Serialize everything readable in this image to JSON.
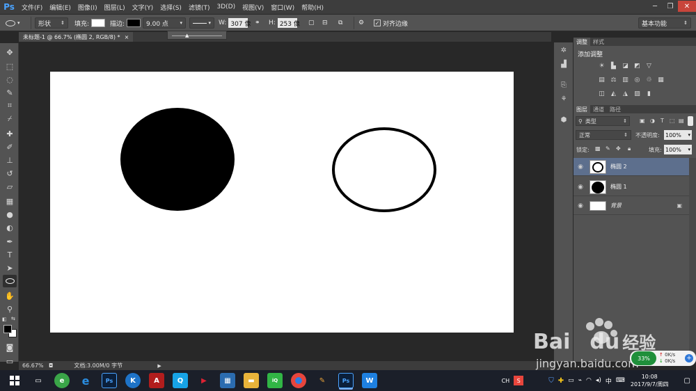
{
  "app": {
    "logo": "Ps"
  },
  "menu": [
    "文件(F)",
    "编辑(E)",
    "图像(I)",
    "图层(L)",
    "文字(Y)",
    "选择(S)",
    "滤镜(T)",
    "3D(D)",
    "视图(V)",
    "窗口(W)",
    "帮助(H)"
  ],
  "options": {
    "tool_mode": "形状",
    "fill_label": "填充:",
    "stroke_label": "描边:",
    "stroke_width": "9.00 点",
    "w_label": "W:",
    "w_value": "307 像",
    "h_label": "H:",
    "h_value": "253 像",
    "align_edges": "对齐边缘",
    "workspace": "基本功能"
  },
  "document": {
    "tab_title": "未标题-1 @ 66.7% (椭圆 2, RGB/8) *",
    "close": "×"
  },
  "status": {
    "zoom": "66.67%",
    "doc_info": "文档:3.00M/0 字节"
  },
  "panels": {
    "adjust_tabs": [
      "调整",
      "样式"
    ],
    "adjust_title": "添加调整",
    "layer_tabs": [
      "图层",
      "通道",
      "路径"
    ],
    "filter_kind": "类型",
    "blend_mode": "正常",
    "opacity_label": "不透明度:",
    "opacity_value": "100%",
    "lock_label": "锁定:",
    "fill_label": "填充:",
    "fill_value": "100%",
    "layers": [
      {
        "name": "椭圆 2"
      },
      {
        "name": "椭圆 1"
      },
      {
        "name": "背景"
      }
    ]
  },
  "taskbar": {
    "ime": "CH",
    "time": "10:08",
    "date": "2017/9/7/周四"
  },
  "net_widget": {
    "percent": "33%",
    "up": "0K/s",
    "down": "0K/s"
  },
  "watermark": {
    "brand": "Bai",
    "brand_b": "du",
    "cn": "经验",
    "url": "jingyan.baidu.com"
  },
  "colors": {
    "accent": "#4aa3ff",
    "selected_layer": "#5d6f8d"
  }
}
